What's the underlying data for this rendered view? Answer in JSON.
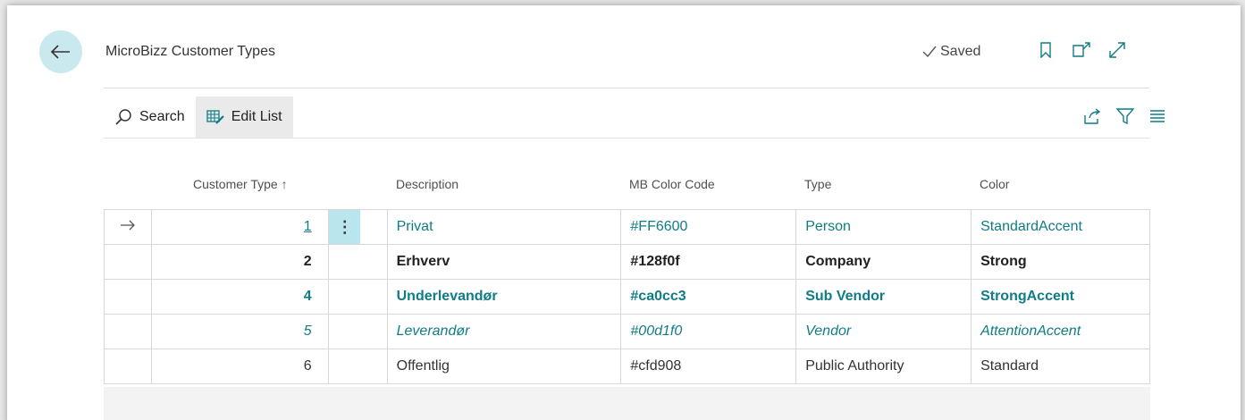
{
  "header": {
    "title": "MicroBizz Customer Types",
    "saved_label": "Saved"
  },
  "toolbar": {
    "search_label": "Search",
    "edit_list_label": "Edit List"
  },
  "columns": {
    "customer_type": "Customer Type",
    "sort_indicator": "↑",
    "description": "Description",
    "mb_color_code": "MB Color Code",
    "type": "Type",
    "color": "Color"
  },
  "rows": [
    {
      "customer_type": "1",
      "description": "Privat",
      "mb_color_code": "#FF6600",
      "type": "Person",
      "color": "StandardAccent",
      "selected": true
    },
    {
      "customer_type": "2",
      "description": "Erhverv",
      "mb_color_code": "#128f0f",
      "type": "Company",
      "color": "Strong"
    },
    {
      "customer_type": "4",
      "description": "Underlevandør",
      "mb_color_code": "#ca0cc3",
      "type": "Sub Vendor",
      "color": "StrongAccent"
    },
    {
      "customer_type": "5",
      "description": "Leverandør",
      "mb_color_code": "#00d1f0",
      "type": "Vendor",
      "color": "AttentionAccent"
    },
    {
      "customer_type": "6",
      "description": "Offentlig",
      "mb_color_code": "#cfd908",
      "type": "Public Authority",
      "color": "Standard"
    }
  ],
  "icons": {
    "back": "back-arrow-icon",
    "saved": "checkmark-icon",
    "bookmark": "bookmark-icon",
    "open_new": "open-new-window-icon",
    "expand": "expand-icon",
    "search": "search-icon",
    "edit_list": "edit-list-icon",
    "share": "share-icon",
    "filter": "filter-icon",
    "list_view": "list-view-icon",
    "row_arrow": "row-arrow-icon",
    "more": "more-options-icon"
  },
  "colors": {
    "accent": "#0f7c86",
    "back_button_bg": "#c9e9ee",
    "selected_cell_bg": "#b9e5ec"
  }
}
